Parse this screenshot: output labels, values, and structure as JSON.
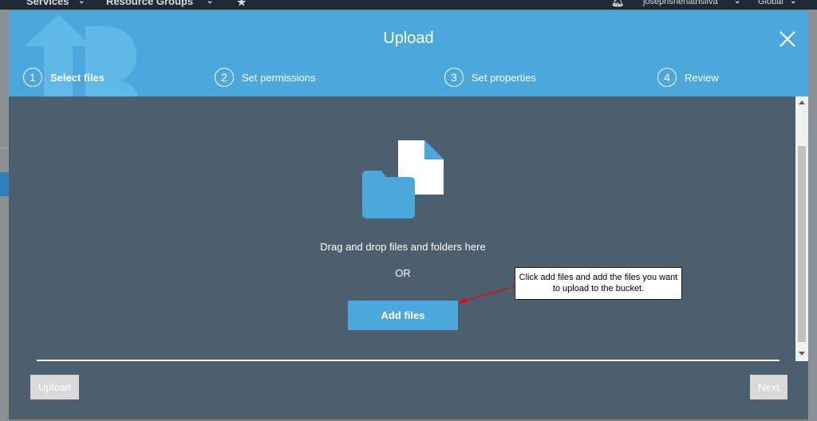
{
  "background": {
    "nav": {
      "services": "Services",
      "resource_groups": "Resource Groups",
      "user": "josephshenathsilva",
      "region": "Global"
    }
  },
  "modal": {
    "title": "Upload",
    "steps": [
      {
        "number": "1",
        "label": "Select files",
        "active": true
      },
      {
        "number": "2",
        "label": "Set permissions",
        "active": false
      },
      {
        "number": "3",
        "label": "Set properties",
        "active": false
      },
      {
        "number": "4",
        "label": "Review",
        "active": false
      }
    ],
    "body": {
      "drop_text": "Drag and drop files and folders here",
      "or_text": "OR",
      "add_files_label": "Add files"
    },
    "callout": {
      "text": "Click add files and add the files you want to upload to the bucket."
    },
    "footer": {
      "upload_label": "Upload",
      "next_label": "Next"
    }
  },
  "colors": {
    "header_blue": "#4ca8dc",
    "body_slate": "#4b5f6e",
    "button_disabled": "#d9d9d9"
  }
}
